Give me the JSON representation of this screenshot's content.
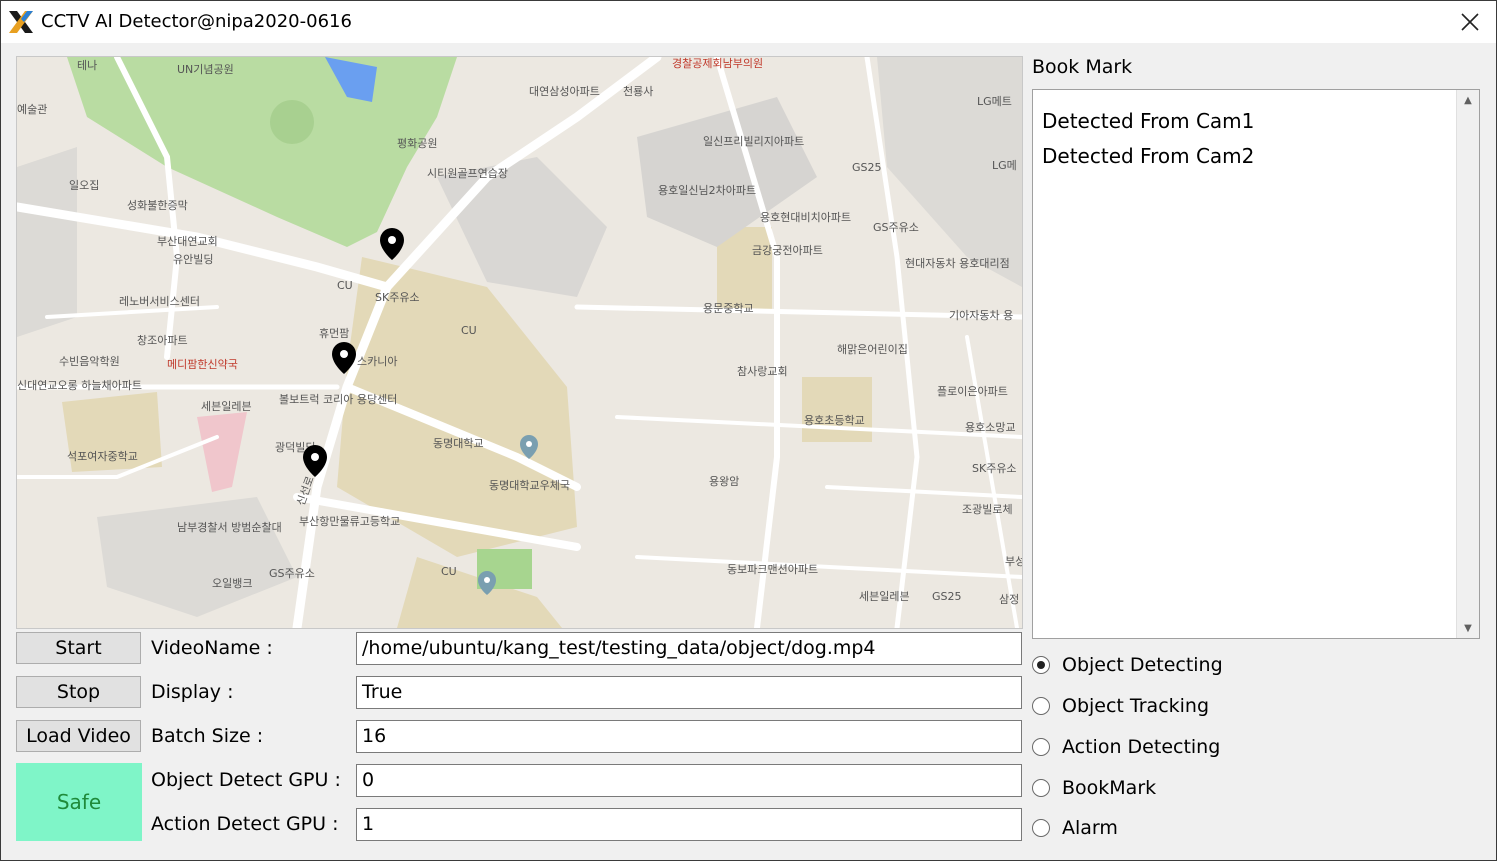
{
  "window": {
    "title": "CCTV AI Detector@nipa2020-0616"
  },
  "map": {
    "labels": [
      "테나",
      "UN기념공원",
      "경찰공제회남부의원",
      "대연삼성아파트",
      "천룡사",
      "LG메트",
      "예술관",
      "평화공원",
      "일신프리빌리지아파트",
      "시티원골프연습장",
      "GS25",
      "LG메",
      "일오집",
      "용호일신님2차아파트",
      "성화불한증막",
      "용호현대비치아파트",
      "GS주유소",
      "부산대연교회",
      "금강궁전아파트",
      "유안빌딩",
      "현대자동차 용호대리점",
      "CU",
      "SK주유소",
      "레노버서비스센터",
      "용문중학교",
      "기아자동차 용",
      "CU",
      "창조아파트",
      "휴먼팜",
      "해맑은어린이집",
      "수빈음악학원",
      "메디팜한신약국",
      "스카니아",
      "참사랑교회",
      "신대연교오롱 하늘채아파트",
      "볼보트럭 코리아 용당센터",
      "플로이은아파트",
      "세븐일레븐",
      "용호초등학교",
      "용호소망교",
      "동명대학교",
      "석포여자중학교",
      "광덕빌딩",
      "SK주유소",
      "동명대학교우체국",
      "용왕암",
      "조광빌로체",
      "남부경찰서 방범순찰대",
      "부산항만물류고등학교",
      "동보파크맨션아파트",
      "CU",
      "오일뱅크",
      "GS주유소",
      "세븐일레븐",
      "GS25",
      "삼정",
      "부성",
      "신선로"
    ]
  },
  "bookmark": {
    "label": "Book Mark",
    "items": [
      "Detected From Cam1",
      "Detected From Cam2"
    ]
  },
  "buttons": {
    "start": "Start",
    "stop": "Stop",
    "load_video": "Load Video"
  },
  "status": {
    "text": "Safe",
    "color": "#7ff5c8"
  },
  "fields": [
    {
      "label": "VideoName :",
      "value": "/home/ubuntu/kang_test/testing_data/object/dog.mp4"
    },
    {
      "label": "Display :",
      "value": "True"
    },
    {
      "label": "Batch Size :",
      "value": "16"
    },
    {
      "label": "Object Detect GPU :",
      "value": "0"
    },
    {
      "label": "Action Detect GPU :",
      "value": "1"
    }
  ],
  "modes": [
    {
      "label": "Object Detecting",
      "selected": true
    },
    {
      "label": "Object Tracking",
      "selected": false
    },
    {
      "label": "Action Detecting",
      "selected": false
    },
    {
      "label": "BookMark",
      "selected": false
    },
    {
      "label": "Alarm",
      "selected": false
    }
  ]
}
